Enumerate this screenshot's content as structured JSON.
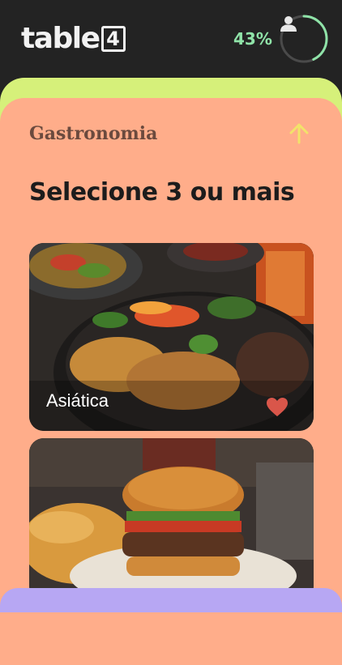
{
  "header": {
    "logo_text": "table",
    "logo_box": "4",
    "progress_percent": 43,
    "progress_label": "43%",
    "avatar_icon": "user-icon"
  },
  "section": {
    "title": "Gastronomia",
    "collapse_icon": "arrow-up-icon",
    "headline": "Selecione 3 ou mais"
  },
  "cards": [
    {
      "label": "Asiática",
      "favorited": true,
      "favorite_icon": "heart-icon"
    },
    {
      "label": "",
      "favorited": false
    }
  ],
  "colors": {
    "background_dark": "#232323",
    "progress_accent": "#8fe3a8",
    "green_layer": "#d6f07a",
    "orange_layer": "#ffad8a",
    "purple_layer": "#b7a7f3",
    "heart": "#d9564a",
    "arrow": "#f2e36a"
  }
}
